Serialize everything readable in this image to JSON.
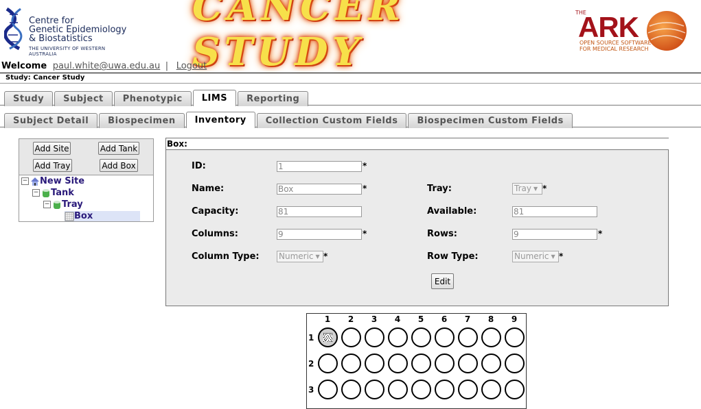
{
  "header": {
    "cgeb_line1": "Centre for",
    "cgeb_line2": "Genetic Epidemiology",
    "cgeb_line3": "& Biostatistics",
    "cgeb_line4": "THE UNIVERSITY OF WESTERN AUSTRALIA",
    "banner_title": "CANCER STUDY",
    "ark_the": "THE",
    "ark_word": "ARK",
    "ark_sub1": "OPEN SOURCE SOFTWARE",
    "ark_sub2": "FOR MEDICAL RESEARCH"
  },
  "user": {
    "welcome_label": "Welcome",
    "email": "paul.white@uwa.edu.au",
    "separator": "|",
    "logout": "Logout"
  },
  "study_label": "Study: Cancer Study",
  "main_tabs": [
    {
      "label": "Study",
      "active": false
    },
    {
      "label": "Subject",
      "active": false
    },
    {
      "label": "Phenotypic",
      "active": false
    },
    {
      "label": "LIMS",
      "active": true
    },
    {
      "label": "Reporting",
      "active": false
    }
  ],
  "sub_tabs": [
    {
      "label": "Subject Detail",
      "active": false
    },
    {
      "label": "Biospecimen",
      "active": false
    },
    {
      "label": "Inventory",
      "active": true
    },
    {
      "label": "Collection Custom Fields",
      "active": false
    },
    {
      "label": "Biospecimen Custom Fields",
      "active": false
    }
  ],
  "tree_buttons": {
    "add_site": "Add Site",
    "add_tank": "Add Tank",
    "add_tray": "Add Tray",
    "add_box": "Add Box"
  },
  "tree": {
    "site": "New Site",
    "tank": "Tank",
    "tray": "Tray",
    "box": "Box"
  },
  "box_form": {
    "heading": "Box:",
    "id_label": "ID:",
    "id_value": "1",
    "name_label": "Name:",
    "name_value": "Box",
    "tray_label": "Tray:",
    "tray_value": "Tray",
    "capacity_label": "Capacity:",
    "capacity_value": "81",
    "available_label": "Available:",
    "available_value": "81",
    "columns_label": "Columns:",
    "columns_value": "9",
    "rows_label": "Rows:",
    "rows_value": "9",
    "column_type_label": "Column Type:",
    "column_type_value": "Numeric",
    "row_type_label": "Row Type:",
    "row_type_value": "Numeric",
    "required_mark": "*",
    "edit_button": "Edit"
  },
  "box_grid": {
    "column_headers": [
      "1",
      "2",
      "3",
      "4",
      "5",
      "6",
      "7",
      "8",
      "9"
    ],
    "row_headers": [
      "1",
      "2",
      "3"
    ],
    "occupied_cells": [
      [
        1,
        1
      ]
    ]
  }
}
